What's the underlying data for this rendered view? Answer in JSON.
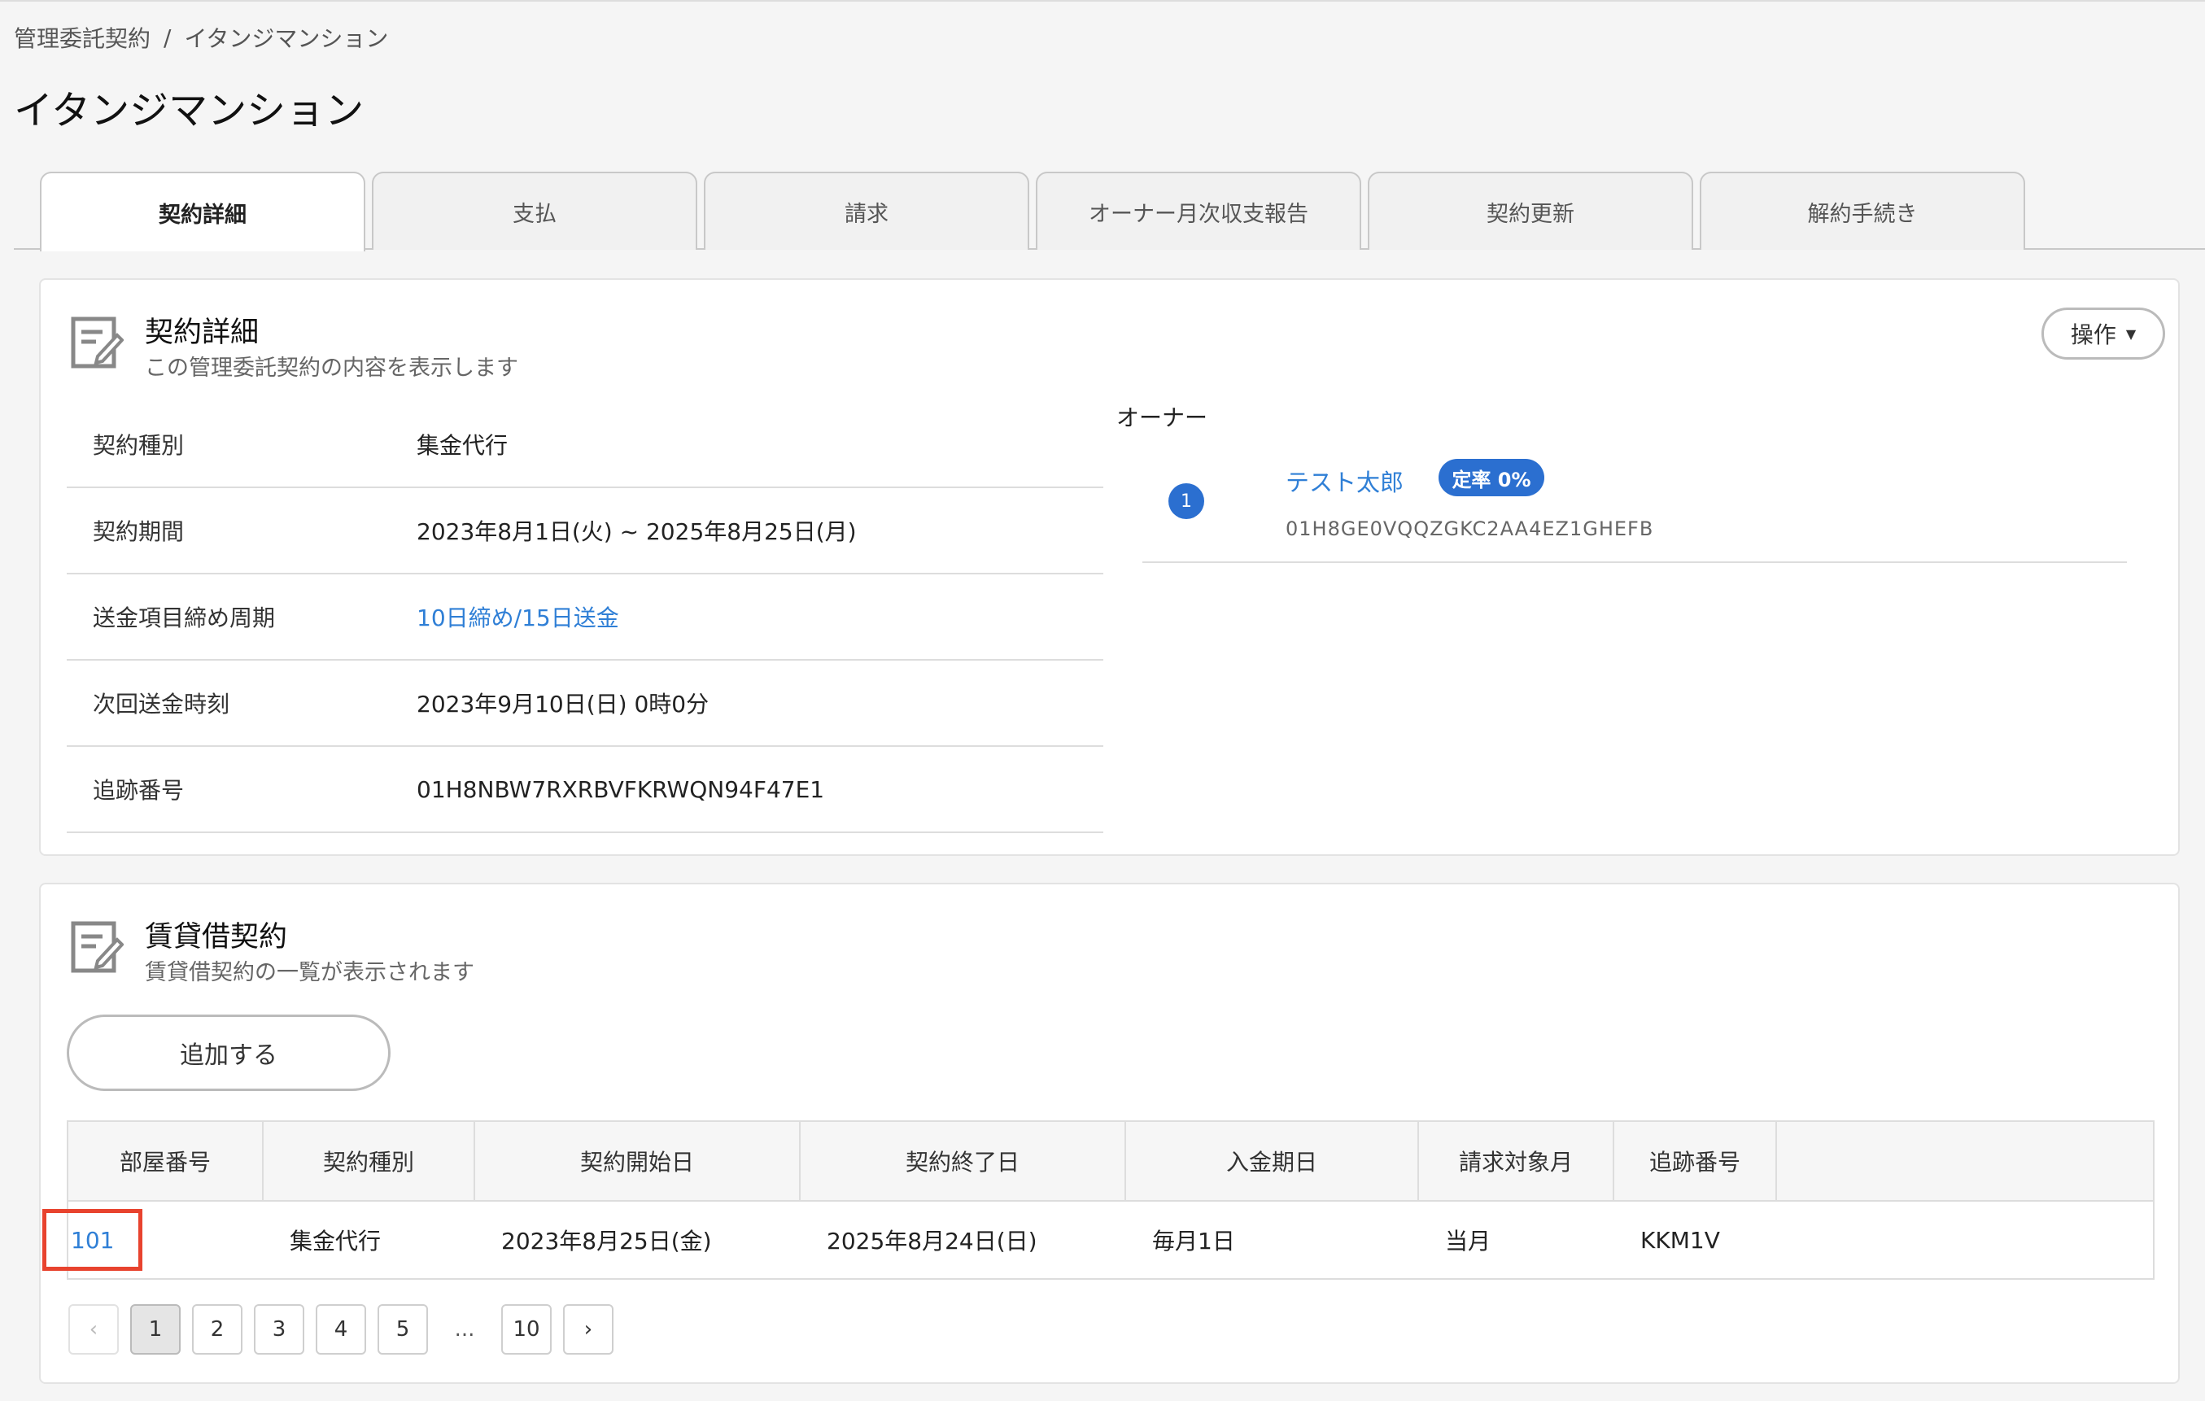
{
  "breadcrumb": {
    "parent": "管理委託契約",
    "separator": "/",
    "current": "イタンジマンション"
  },
  "page_title": "イタンジマンション",
  "tabs": [
    {
      "label": "契約詳細",
      "active": true
    },
    {
      "label": "支払"
    },
    {
      "label": "請求"
    },
    {
      "label": "オーナー月次収支報告"
    },
    {
      "label": "契約更新"
    },
    {
      "label": "解約手続き"
    }
  ],
  "contract_detail": {
    "title": "契約詳細",
    "subtitle": "この管理委託契約の内容を表示します",
    "ops_label": "操作",
    "rows": [
      {
        "label": "契約種別",
        "value": "集金代行"
      },
      {
        "label": "契約期間",
        "value": "2023年8月1日(火) ~ 2025年8月25日(月)"
      },
      {
        "label": "送金項目締め周期",
        "value": "10日締め/15日送金"
      },
      {
        "label": "次回送金時刻",
        "value": "2023年9月10日(日) 0時0分"
      },
      {
        "label": "追跡番号",
        "value": "01H8NBW7RXRBVFKRWQN94F47E1"
      }
    ],
    "owner": {
      "heading": "オーナー",
      "number": "1",
      "name": "テスト太郎",
      "badge": "定率 0%",
      "id": "01H8GE0VQQZGKC2AA4EZ1GHEFB"
    }
  },
  "lease": {
    "title": "賃貸借契約",
    "subtitle": "賃貸借契約の一覧が表示されます",
    "add_label": "追加する",
    "columns": [
      "部屋番号",
      "契約種別",
      "契約開始日",
      "契約終了日",
      "入金期日",
      "請求対象月",
      "追跡番号",
      ""
    ],
    "rows": [
      {
        "room": "101",
        "type": "集金代行",
        "start": "2023年8月25日(金)",
        "end": "2025年8月24日(日)",
        "due": "毎月1日",
        "month": "当月",
        "tracking": "KKM1V"
      }
    ],
    "pagination": {
      "prev": "‹",
      "pages": [
        "1",
        "2",
        "3",
        "4",
        "5"
      ],
      "ellipsis": "...",
      "last": "10",
      "next": "›"
    }
  },
  "colors": {
    "link": "#2f7fd6",
    "badge": "#2b6fd0",
    "highlight": "#e8432e"
  }
}
